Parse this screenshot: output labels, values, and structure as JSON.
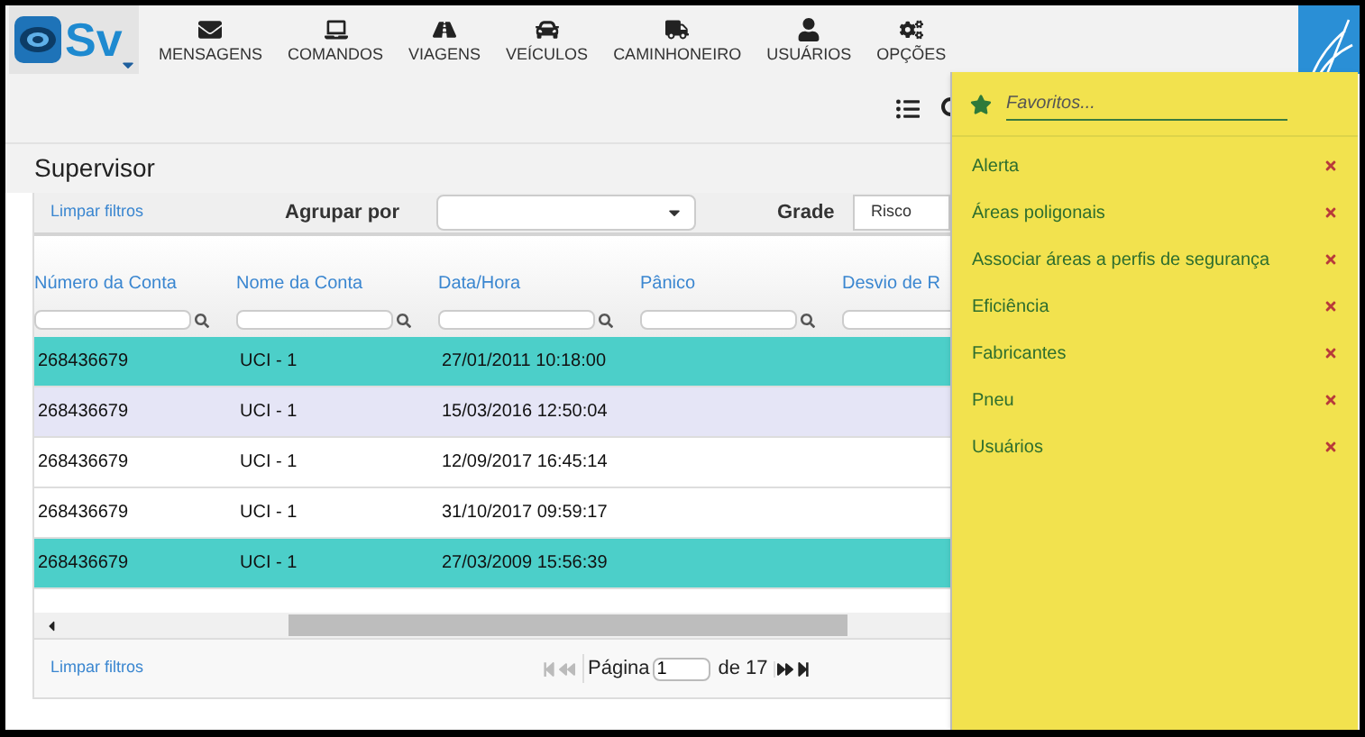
{
  "logo": {
    "text": "Sv"
  },
  "nav": [
    {
      "label": "MENSAGENS",
      "kind": "envelope"
    },
    {
      "label": "COMANDOS",
      "kind": "laptop"
    },
    {
      "label": "VIAGENS",
      "kind": "road"
    },
    {
      "label": "VEÍCULOS",
      "kind": "car"
    },
    {
      "label": "CAMINHONEIRO",
      "kind": "truck"
    },
    {
      "label": "USUÁRIOS",
      "kind": "user"
    },
    {
      "label": "OPÇÕES",
      "kind": "gears"
    }
  ],
  "page_title": "Supervisor",
  "filters": {
    "clear": "Limpar filtros",
    "group_label": "Agrupar por",
    "grid_label": "Grade",
    "grid_value": "Risco"
  },
  "table": {
    "columns": [
      "Número da Conta",
      "Nome da Conta",
      "Data/Hora",
      "Pânico",
      "Desvio de R"
    ],
    "rows": [
      {
        "cells": [
          "268436679",
          "UCI - 1",
          "27/01/2011 10:18:00"
        ],
        "selected": true,
        "hovered": false
      },
      {
        "cells": [
          "268436679",
          "UCI - 1",
          "15/03/2016 12:50:04"
        ],
        "selected": false,
        "hovered": true
      },
      {
        "cells": [
          "268436679",
          "UCI - 1",
          "12/09/2017 16:45:14"
        ],
        "selected": false,
        "hovered": false
      },
      {
        "cells": [
          "268436679",
          "UCI - 1",
          "31/10/2017 09:59:17"
        ],
        "selected": false,
        "hovered": false
      },
      {
        "cells": [
          "268436679",
          "UCI - 1",
          "27/03/2009 15:56:39"
        ],
        "selected": true,
        "hovered": false
      }
    ]
  },
  "footer": {
    "clear": "Limpar filtros",
    "page_label": "Página",
    "page": "1",
    "total": "de 17",
    "back_disabled": true,
    "forward_disabled": false
  },
  "favorites": {
    "placeholder": "Favoritos...",
    "items": [
      "Alerta",
      "Áreas poligonais",
      "Associar áreas a perfis de segurança",
      "Eficiência",
      "Fabricantes",
      "Pneu",
      "Usuários"
    ]
  }
}
